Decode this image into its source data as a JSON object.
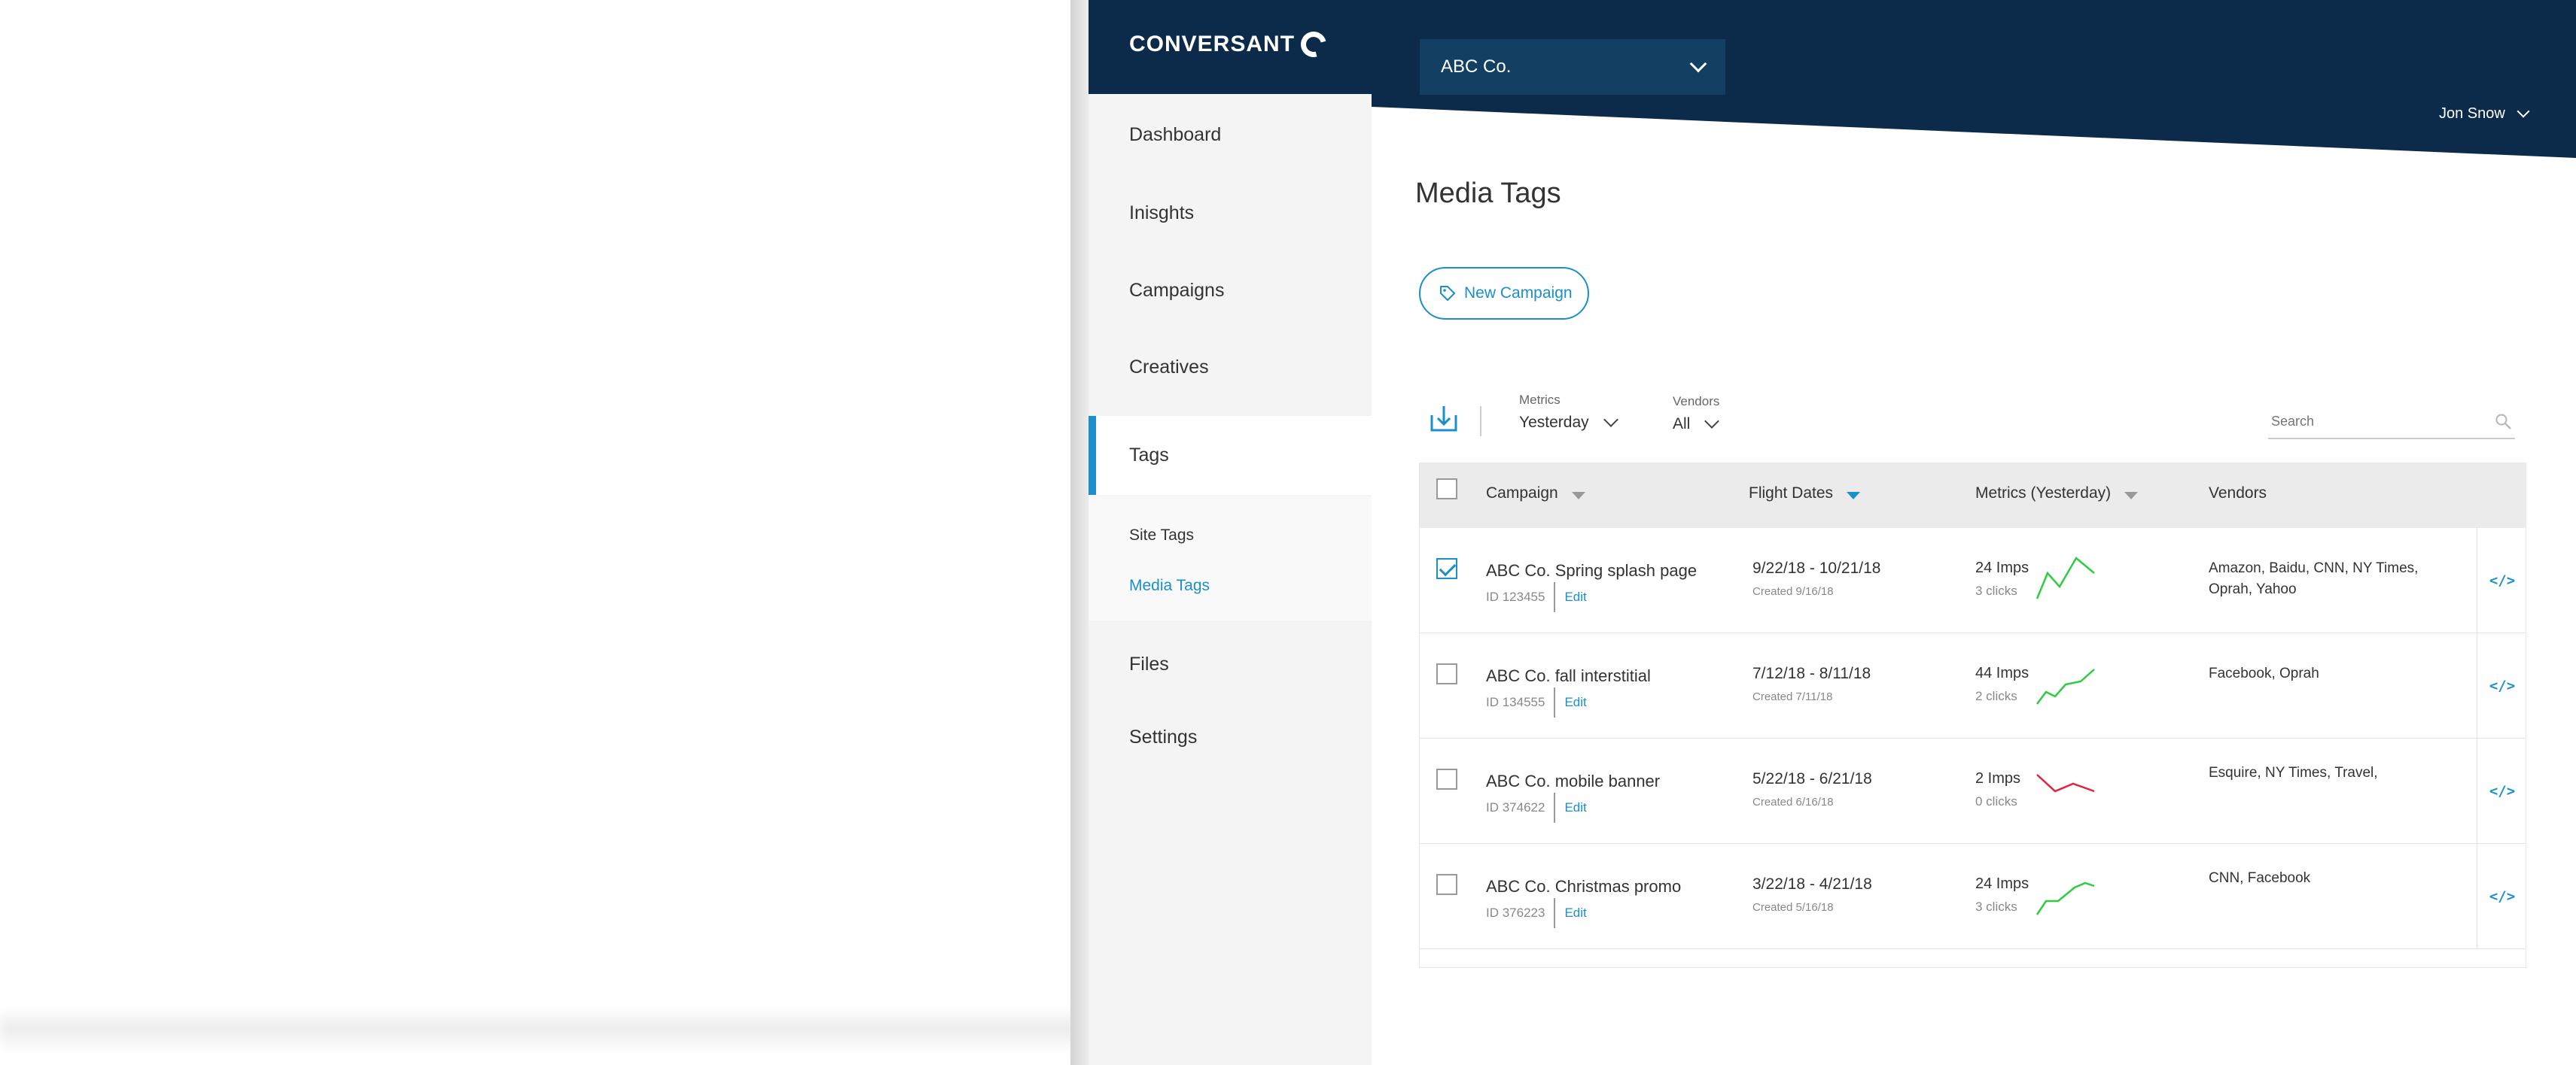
{
  "brand": {
    "name": "CONVERSANT"
  },
  "org_select": {
    "value": "ABC Co."
  },
  "user": {
    "name": "Jon Snow"
  },
  "sidebar": {
    "items": [
      {
        "label": "Dashboard"
      },
      {
        "label": "Inisghts"
      },
      {
        "label": "Campaigns"
      },
      {
        "label": "Creatives"
      },
      {
        "label": "Tags"
      },
      {
        "label": "Files"
      },
      {
        "label": "Settings"
      }
    ],
    "subitems": [
      {
        "label": "Site Tags"
      },
      {
        "label": "Media Tags"
      }
    ]
  },
  "page": {
    "title": "Media Tags",
    "new_campaign_label": "New Campaign"
  },
  "filters": {
    "metrics": {
      "label": "Metrics",
      "value": "Yesterday"
    },
    "vendors": {
      "label": "Vendors",
      "value": "All"
    },
    "search_placeholder": "Search"
  },
  "table": {
    "headers": {
      "campaign": "Campaign",
      "flight_dates": "Flight Dates",
      "metrics": "Metrics (Yesterday)",
      "vendors": "Vendors"
    },
    "edit_label": "Edit",
    "code_icon": "</>",
    "rows": [
      {
        "checked": true,
        "name": "ABC Co. Spring splash page",
        "id": "ID 123455",
        "dates": "9/22/18 - 10/21/18",
        "created": "Created 9/16/18",
        "imps": "24 Imps",
        "clicks": "3 clicks",
        "trend": "up",
        "vendors": "Amazon, Baidu, CNN, NY Times, Oprah, Yahoo"
      },
      {
        "checked": false,
        "name": "ABC Co. fall interstitial",
        "id": "ID 134555",
        "dates": "7/12/18 - 8/11/18",
        "created": "Created 7/11/18",
        "imps": "44 Imps",
        "clicks": "2 clicks",
        "trend": "up",
        "vendors": "Facebook, Oprah"
      },
      {
        "checked": false,
        "name": "ABC Co. mobile banner",
        "id": "ID 374622",
        "dates": "5/22/18 - 6/21/18",
        "created": "Created 6/16/18",
        "imps": "2 Imps",
        "clicks": "0 clicks",
        "trend": "down",
        "vendors": "Esquire, NY Times, Travel,"
      },
      {
        "checked": false,
        "name": "ABC Co. Christmas promo",
        "id": "ID 376223",
        "dates": "3/22/18 - 4/21/18",
        "created": "Created 5/16/18",
        "imps": "24 Imps",
        "clicks": "3 clicks",
        "trend": "up",
        "vendors": "CNN, Facebook"
      }
    ]
  },
  "colors": {
    "navy": "#0c2a4a",
    "accent": "#1a8fca",
    "trend_up": "#2ecc40",
    "trend_down": "#e0243c"
  }
}
